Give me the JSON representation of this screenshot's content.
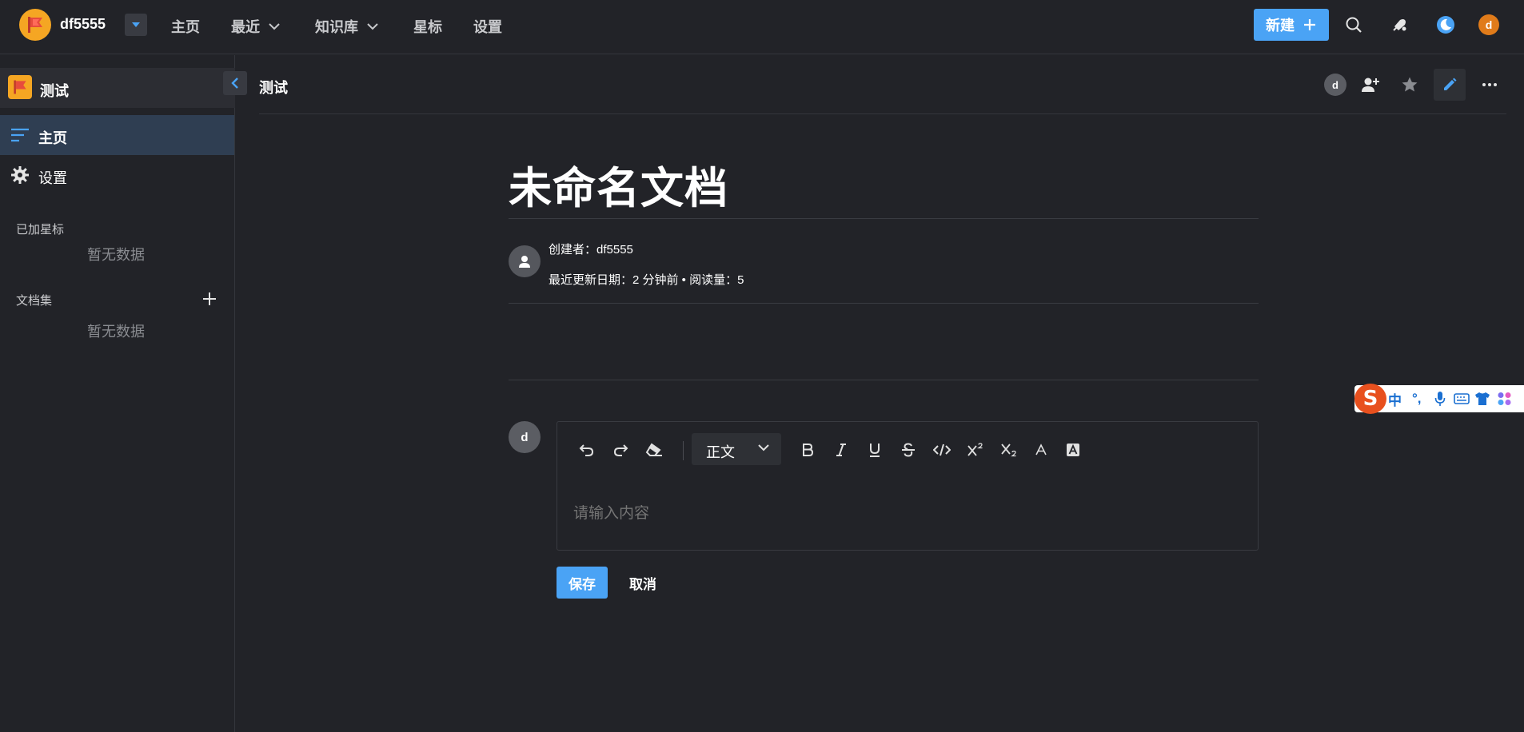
{
  "topbar": {
    "org_name": "df5555",
    "nav": [
      {
        "label": "主页"
      },
      {
        "label": "最近"
      },
      {
        "label": "知识库"
      },
      {
        "label": "星标"
      },
      {
        "label": "设置"
      }
    ],
    "new_button": "新建",
    "user_avatar": "d"
  },
  "sidebar": {
    "space_name": "测试",
    "items": [
      {
        "label": "主页",
        "icon": "list-icon",
        "active": true
      },
      {
        "label": "设置",
        "icon": "gear-icon",
        "active": false
      }
    ],
    "starred_title": "已加星标",
    "starred_empty": "暂无数据",
    "collections_title": "文档集",
    "collections_empty": "暂无数据"
  },
  "doc_header": {
    "breadcrumb": "测试",
    "member_avatar": "d"
  },
  "document": {
    "title": "未命名文档",
    "author_line": "创建者：df5555",
    "meta_line": "最近更新日期：2 分钟前 • 阅读量：5"
  },
  "comment": {
    "avatar": "d",
    "paragraph_style": "正文",
    "placeholder": "请输入内容",
    "save_label": "保存",
    "cancel_label": "取消"
  },
  "ime": {
    "items": [
      "中",
      "°,"
    ]
  },
  "colors": {
    "accent": "#4aa3f5",
    "background": "#222328",
    "brand": "#f5a623"
  }
}
